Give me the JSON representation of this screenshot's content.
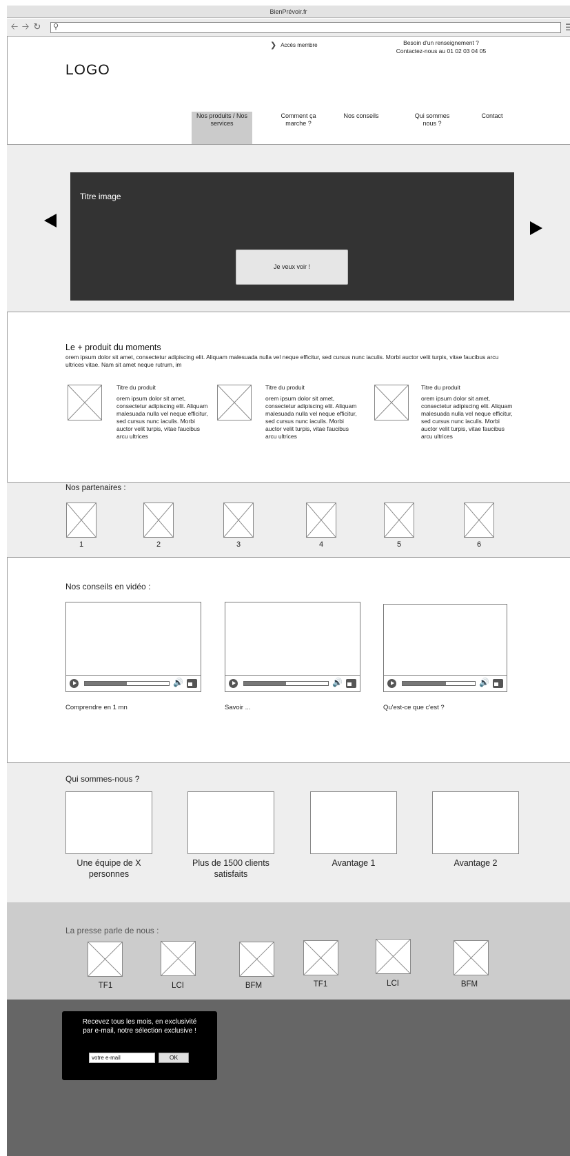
{
  "browser": {
    "title": "BienPrévoir.fr",
    "url": ""
  },
  "header": {
    "member_link": "Accès membre",
    "contact_line1": "Besoin d'un renseignement ?",
    "contact_line2": "Contactez-nous au 01 02 03 04 05",
    "logo": "LOGO"
  },
  "nav": {
    "items": [
      {
        "label_l1": "Nos produits / Nos",
        "label_l2": "services"
      },
      {
        "label_l1": "Comment ça",
        "label_l2": "marche ?"
      },
      {
        "label_l1": "Nos conseils",
        "label_l2": ""
      },
      {
        "label_l1": "Qui sommes",
        "label_l2": "nous ?"
      },
      {
        "label_l1": "Contact",
        "label_l2": ""
      }
    ]
  },
  "hero": {
    "title": "Titre image",
    "cta": "Je veux voir !"
  },
  "produit": {
    "title": "Le + produit du moments",
    "description": "orem ipsum dolor sit amet, consectetur adipiscing elit. Aliquam malesuada nulla vel neque efficitur, sed cursus nunc iaculis. Morbi auctor velit turpis, vitae faucibus arcu ultrices vitae. Nam sit amet neque rutrum, im",
    "items": [
      {
        "title": "Titre du produit",
        "text": "orem ipsum dolor sit amet, consectetur adipiscing elit. Aliquam malesuada nulla vel neque efficitur, sed cursus nunc iaculis. Morbi auctor velit turpis, vitae faucibus arcu ultrices"
      },
      {
        "title": "Titre du produit",
        "text": "orem ipsum dolor sit amet, consectetur adipiscing elit. Aliquam malesuada nulla vel neque efficitur, sed cursus nunc iaculis. Morbi auctor velit turpis, vitae faucibus arcu ultrices"
      },
      {
        "title": "Titre du produit",
        "text": "orem ipsum dolor sit amet, consectetur adipiscing elit. Aliquam malesuada nulla vel neque efficitur, sed cursus nunc iaculis. Morbi auctor velit turpis, vitae faucibus arcu ultrices"
      }
    ]
  },
  "partners": {
    "title": "Nos partenaires :",
    "labels": [
      "1",
      "2",
      "3",
      "4",
      "5",
      "6"
    ]
  },
  "videos": {
    "title": "Nos conseils en vidéo :",
    "items": [
      {
        "caption": "Comprendre en 1 mn",
        "progress": 0.5
      },
      {
        "caption": "Savoir ...",
        "progress": 0.5
      },
      {
        "caption": "Qu'est-ce que c'est ?",
        "progress": 0.6
      }
    ]
  },
  "about": {
    "title": "Qui sommes-nous ?",
    "items": [
      {
        "l1": "Une équipe de X",
        "l2": "personnes"
      },
      {
        "l1": "Plus de 1500 clients",
        "l2": "satisfaits"
      },
      {
        "l1": "Avantage 1",
        "l2": ""
      },
      {
        "l1": "Avantage 2",
        "l2": ""
      }
    ]
  },
  "press": {
    "title": "La presse parle de nous :",
    "labels": [
      "TF1",
      "LCI",
      "BFM",
      "TF1",
      "LCI",
      "BFM"
    ]
  },
  "newsletter": {
    "text_l1": "Recevez tous les mois, en exclusivité",
    "text_l2": "par e-mail, notre sélection exclusive !",
    "input_value": "votre e-mail",
    "button": "OK"
  },
  "colors": {
    "hero_bg": "#eeeeee",
    "slide_bg": "#333333",
    "nav_active_bg": "#cbcbcb",
    "press_bg": "#cccccc",
    "footer_bg": "#666666",
    "newsletter_bg": "#000000"
  }
}
